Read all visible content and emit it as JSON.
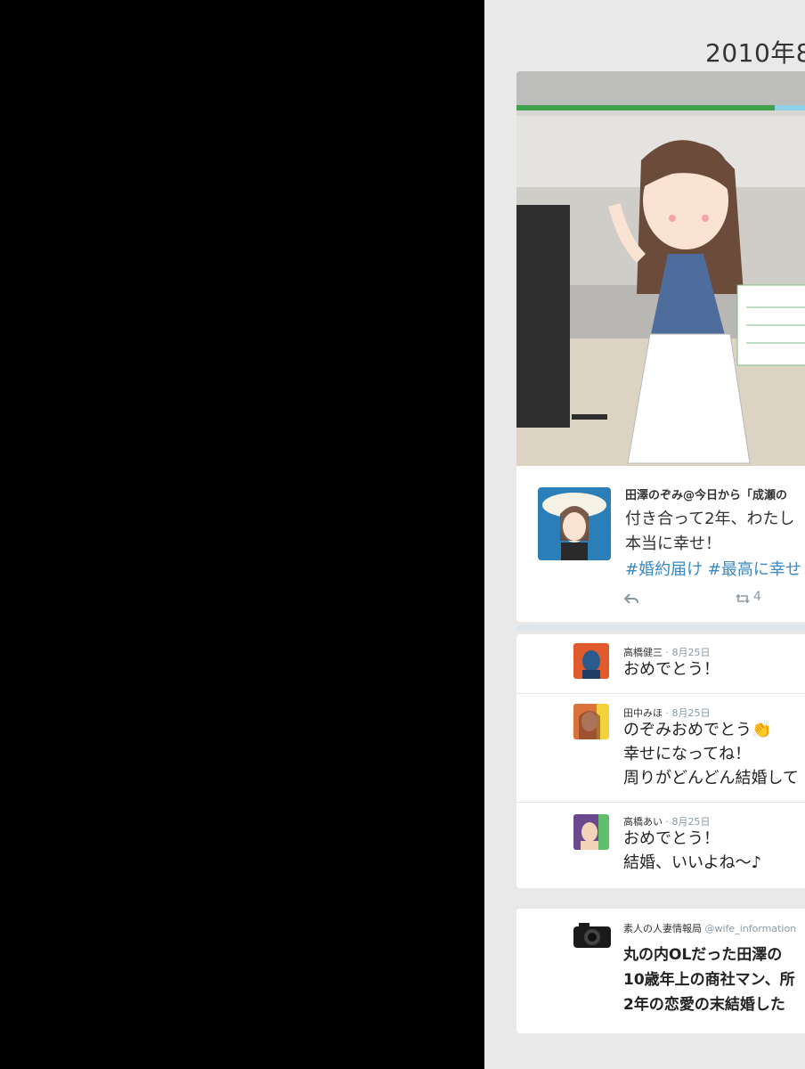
{
  "header": {
    "date": "2010年8"
  },
  "main_tweet": {
    "author": "田澤のぞみ@今日から「成瀬の",
    "text_line1": "付き合って2年、わたし",
    "text_line2": "本当に幸せ！",
    "hashtags": "#婚約届け #最高に幸せ",
    "retweet_count": "4"
  },
  "replies": [
    {
      "name": "高橋健三",
      "date": "· 8月25日",
      "lines": [
        "おめでとう！"
      ]
    },
    {
      "name": "田中みほ",
      "date": "· 8月25日",
      "lines": [
        "のぞみおめでとう👏",
        "幸せになってね！",
        "周りがどんどん結婚して"
      ]
    },
    {
      "name": "高橋あい",
      "date": "· 8月25日",
      "lines": [
        "おめでとう！",
        "結婚、いいよね〜♪"
      ]
    }
  ],
  "bottom_tweet": {
    "author": "素人の人妻情報局",
    "handle": "@wife_information",
    "lines": [
      "丸の内OLだった田澤の",
      "10歳年上の商社マン、所",
      "2年の恋愛の末結婚した"
    ]
  }
}
